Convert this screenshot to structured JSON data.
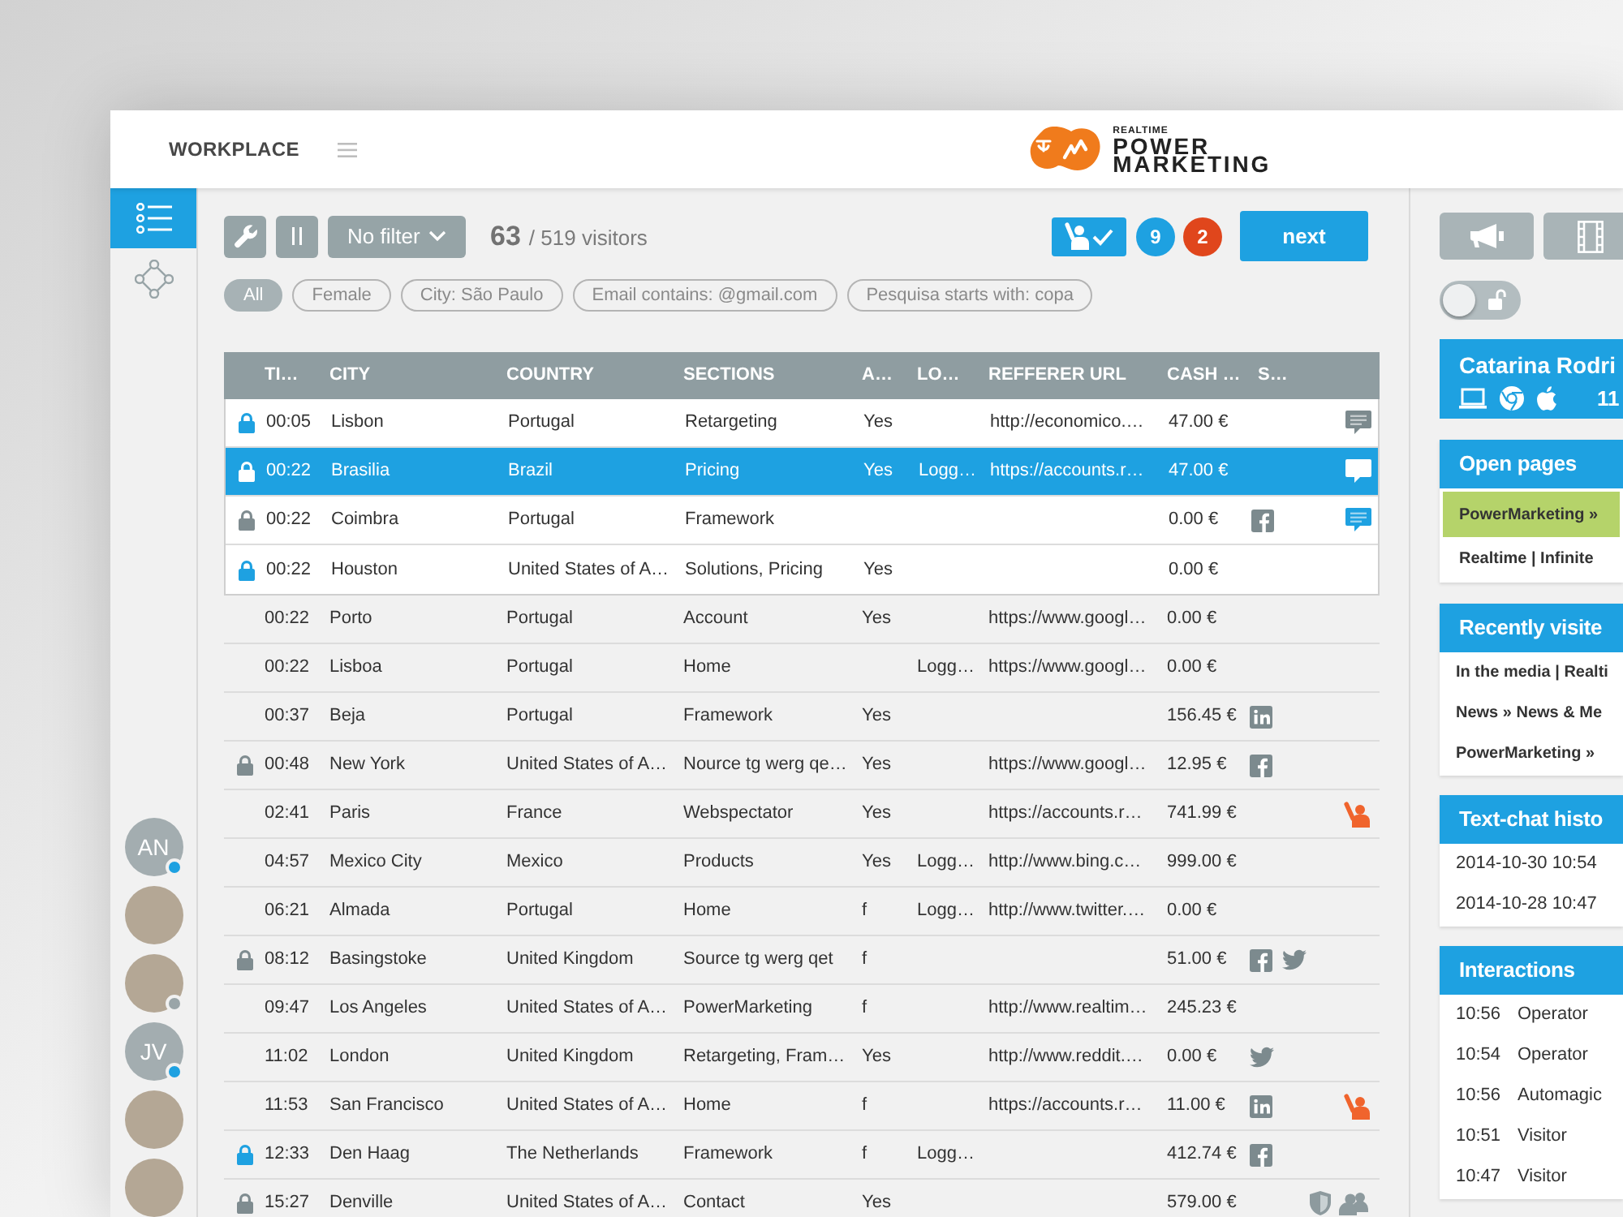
{
  "header": {
    "title": "WORKPLACE",
    "logo": {
      "tagline": "REALTIME",
      "line_1": "POWER",
      "line_2": "MARKETING"
    }
  },
  "sidebar": {
    "items": [
      {
        "kind": "list",
        "selected": true
      },
      {
        "kind": "diagram",
        "selected": false
      }
    ],
    "avatars": [
      {
        "kind": "initials",
        "initials": "AN",
        "color": "#1ea1e1"
      },
      {
        "kind": "photo"
      },
      {
        "kind": "photo",
        "color": "#9aa5a8"
      },
      {
        "kind": "initials",
        "initials": "JV",
        "color": "#1ea1e1"
      },
      {
        "kind": "photo"
      },
      {
        "kind": "photo"
      }
    ]
  },
  "toolbar": {
    "filter": "No filter",
    "count": "63",
    "total": "/ 519 visitors",
    "badges": [
      {
        "text": "9",
        "color": "#1ea1e1"
      },
      {
        "text": "2",
        "color": "#e0461c"
      }
    ],
    "next": "next"
  },
  "filters": [
    {
      "label": "All",
      "selected": true
    },
    {
      "label": "Female",
      "selected": false
    },
    {
      "label": "City: São Paulo",
      "selected": false
    },
    {
      "label": "Email contains: @gmail.com",
      "selected": false
    },
    {
      "label": "Pesquisa starts with: copa",
      "selected": false
    }
  ],
  "table": {
    "columns": [
      "TI…",
      "CITY",
      "COUNTRY",
      "SECTIONS",
      "A…",
      "LO…",
      "REFFERER URL",
      "CASH …",
      "S…"
    ],
    "pinned_rows": [
      {
        "lock": {
          "highlighted": true
        },
        "column_1": "00:05",
        "city": "Lisbon",
        "country": "Portugal",
        "sections": "Retargeting",
        "column_5": "Yes",
        "referrer_url": "http://economico.…",
        "column_8": "47.00 €",
        "status": [
          {
            "kind": "chat",
            "highlighted": false
          }
        ],
        "selected": false
      },
      {
        "lock": {
          "highlighted": true
        },
        "column_1": "00:22",
        "city": "Brasilia",
        "country": "Brazil",
        "sections": "Pricing",
        "column_5": "Yes",
        "column_6": "Logg…",
        "referrer_url": "https://accounts.r…",
        "column_8": "47.00 €",
        "status": [
          {
            "kind": "chat",
            "highlighted": false
          }
        ],
        "selected": true
      },
      {
        "lock": {
          "highlighted": false
        },
        "column_1": "00:22",
        "city": "Coimbra",
        "country": "Portugal",
        "sections": "Framework",
        "column_8": "0.00 €",
        "social": [
          {
            "kind": "facebook"
          }
        ],
        "status": [
          {
            "kind": "chat",
            "highlighted": true
          }
        ],
        "selected": false
      },
      {
        "lock": {
          "highlighted": true
        },
        "column_1": "00:22",
        "city": "Houston",
        "country": "United States of A…",
        "sections": "Solutions, Pricing",
        "column_5": "Yes",
        "column_8": "0.00 €",
        "selected": false
      }
    ],
    "rows": [
      {
        "column_1": "00:22",
        "city": "Porto",
        "country": "Portugal",
        "sections": "Account",
        "column_5": "Yes",
        "referrer_url": "https://www.googl…",
        "column_8": "0.00 €",
        "selected": false
      },
      {
        "column_1": "00:22",
        "city": "Lisboa",
        "country": "Portugal",
        "sections": "Home",
        "column_6": "Logg…",
        "referrer_url": "https://www.googl…",
        "column_8": "0.00 €",
        "selected": false
      },
      {
        "column_1": "00:37",
        "city": "Beja",
        "country": "Portugal",
        "sections": "Framework",
        "column_5": "Yes",
        "column_8": "156.45 €",
        "social": [
          {
            "kind": "linkedin"
          }
        ],
        "selected": false
      },
      {
        "lock": {
          "highlighted": false
        },
        "column_1": "00:48",
        "city": "New York",
        "country": "United States of A…",
        "sections": "Nource tg werg qe…",
        "column_5": "Yes",
        "referrer_url": "https://www.googl…",
        "column_8": "12.95 €",
        "social": [
          {
            "kind": "facebook"
          }
        ],
        "selected": false
      },
      {
        "column_1": "02:41",
        "city": "Paris",
        "country": "France",
        "sections": "Webspectator",
        "column_5": "Yes",
        "referrer_url": "https://accounts.r…",
        "column_8": "741.99 €",
        "status": [
          {
            "kind": "raised_hand"
          }
        ],
        "selected": false
      },
      {
        "column_1": "04:57",
        "city": "Mexico City",
        "country": "Mexico",
        "sections": "Products",
        "column_5": "Yes",
        "column_6": "Logg…",
        "referrer_url": "http://www.bing.c…",
        "column_8": "999.00 €",
        "selected": false
      },
      {
        "column_1": "06:21",
        "city": "Almada",
        "country": "Portugal",
        "sections": "Home",
        "column_5": "f",
        "column_6": "Logg…",
        "referrer_url": "http://www.twitter.…",
        "column_8": "0.00 €",
        "selected": false
      },
      {
        "lock": {
          "highlighted": false
        },
        "column_1": "08:12",
        "city": "Basingstoke",
        "country": "United Kingdom",
        "sections": "Source tg werg qet",
        "column_5": "f",
        "column_8": "51.00 €",
        "social": [
          {
            "kind": "facebook"
          },
          {
            "kind": "twitter"
          }
        ],
        "selected": false
      },
      {
        "column_1": "09:47",
        "city": "Los Angeles",
        "country": "United States of A…",
        "sections": "PowerMarketing",
        "column_5": "f",
        "referrer_url": "http://www.realtim…",
        "column_8": "245.23 €",
        "selected": false
      },
      {
        "column_1": "11:02",
        "city": "London",
        "country": "United Kingdom",
        "sections": "Retargeting, Fram…",
        "column_5": "Yes",
        "referrer_url": "http://www.reddit.…",
        "column_8": "0.00 €",
        "social": [
          {
            "kind": "twitter"
          }
        ],
        "selected": false
      },
      {
        "column_1": "11:53",
        "city": "San Francisco",
        "country": "United States of A…",
        "sections": "Home",
        "column_5": "f",
        "referrer_url": "https://accounts.r…",
        "column_8": "11.00 €",
        "social": [
          {
            "kind": "linkedin"
          }
        ],
        "status": [
          {
            "kind": "raised_hand"
          }
        ],
        "selected": false
      },
      {
        "lock": {
          "highlighted": true
        },
        "column_1": "12:33",
        "city": "Den Haag",
        "country": "The Netherlands",
        "sections": "Framework",
        "column_5": "f",
        "column_6": "Logg…",
        "column_8": "412.74 €",
        "social": [
          {
            "kind": "facebook"
          }
        ],
        "selected": false
      },
      {
        "lock": {
          "highlighted": false
        },
        "column_1": "15:27",
        "city": "Denville",
        "country": "United States of A…",
        "sections": "Contact",
        "column_5": "Yes",
        "column_8": "579.00 €",
        "status": [
          {
            "kind": "shield"
          },
          {
            "kind": "users"
          }
        ],
        "selected": false
      }
    ]
  },
  "side_panel": {
    "lock_toggle": {
      "on": false
    },
    "visitor": {
      "name": "Catarina Rodri",
      "time": "11"
    },
    "open_pages": {
      "title": "Open pages",
      "items": [
        {
          "text": "PowerMarketing »",
          "selected": true
        },
        {
          "text": "Realtime | Infinite",
          "selected": false
        }
      ]
    },
    "recently_visited": {
      "title": "Recently visite",
      "items": [
        "In the media | Realti",
        "News » News & Me",
        "PowerMarketing »"
      ]
    },
    "chat_history": {
      "title": "Text-chat histo",
      "items": [
        "2014-10-30 10:54",
        "2014-10-28 10:47"
      ]
    },
    "interactions": {
      "title": "Interactions",
      "items": [
        {
          "time": "10:56",
          "actor": "Operator"
        },
        {
          "time": "10:54",
          "actor": "Operator"
        },
        {
          "time": "10:56",
          "actor": "Automagic"
        },
        {
          "time": "10:51",
          "actor": "Visitor"
        },
        {
          "time": "10:47",
          "actor": "Visitor"
        }
      ]
    }
  }
}
